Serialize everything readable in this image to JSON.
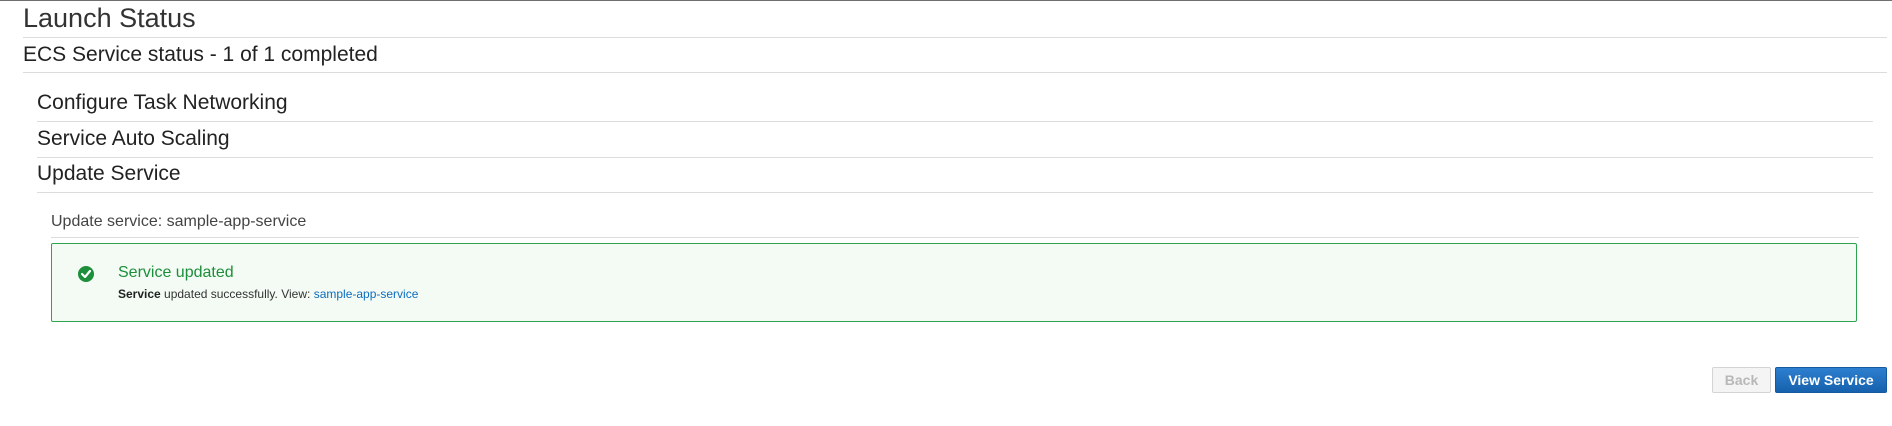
{
  "page": {
    "title": "Launch Status"
  },
  "service_status": {
    "heading": "ECS Service status - 1 of 1 completed"
  },
  "steps": [
    {
      "label": "Configure Task Networking"
    },
    {
      "label": "Service Auto Scaling"
    },
    {
      "label": "Update Service"
    }
  ],
  "update_detail": {
    "text": "Update service: sample-app-service"
  },
  "alert": {
    "status": "success",
    "icon": "check-circle-icon",
    "color": "#1d8f3a",
    "title": "Service updated",
    "body_bold": "Service",
    "body_text": " updated successfully. View: ",
    "link_text": "sample-app-service"
  },
  "actions": {
    "back_label": "Back",
    "back_disabled": true,
    "primary_label": "View Service",
    "primary_color": "#1f6fc0"
  }
}
